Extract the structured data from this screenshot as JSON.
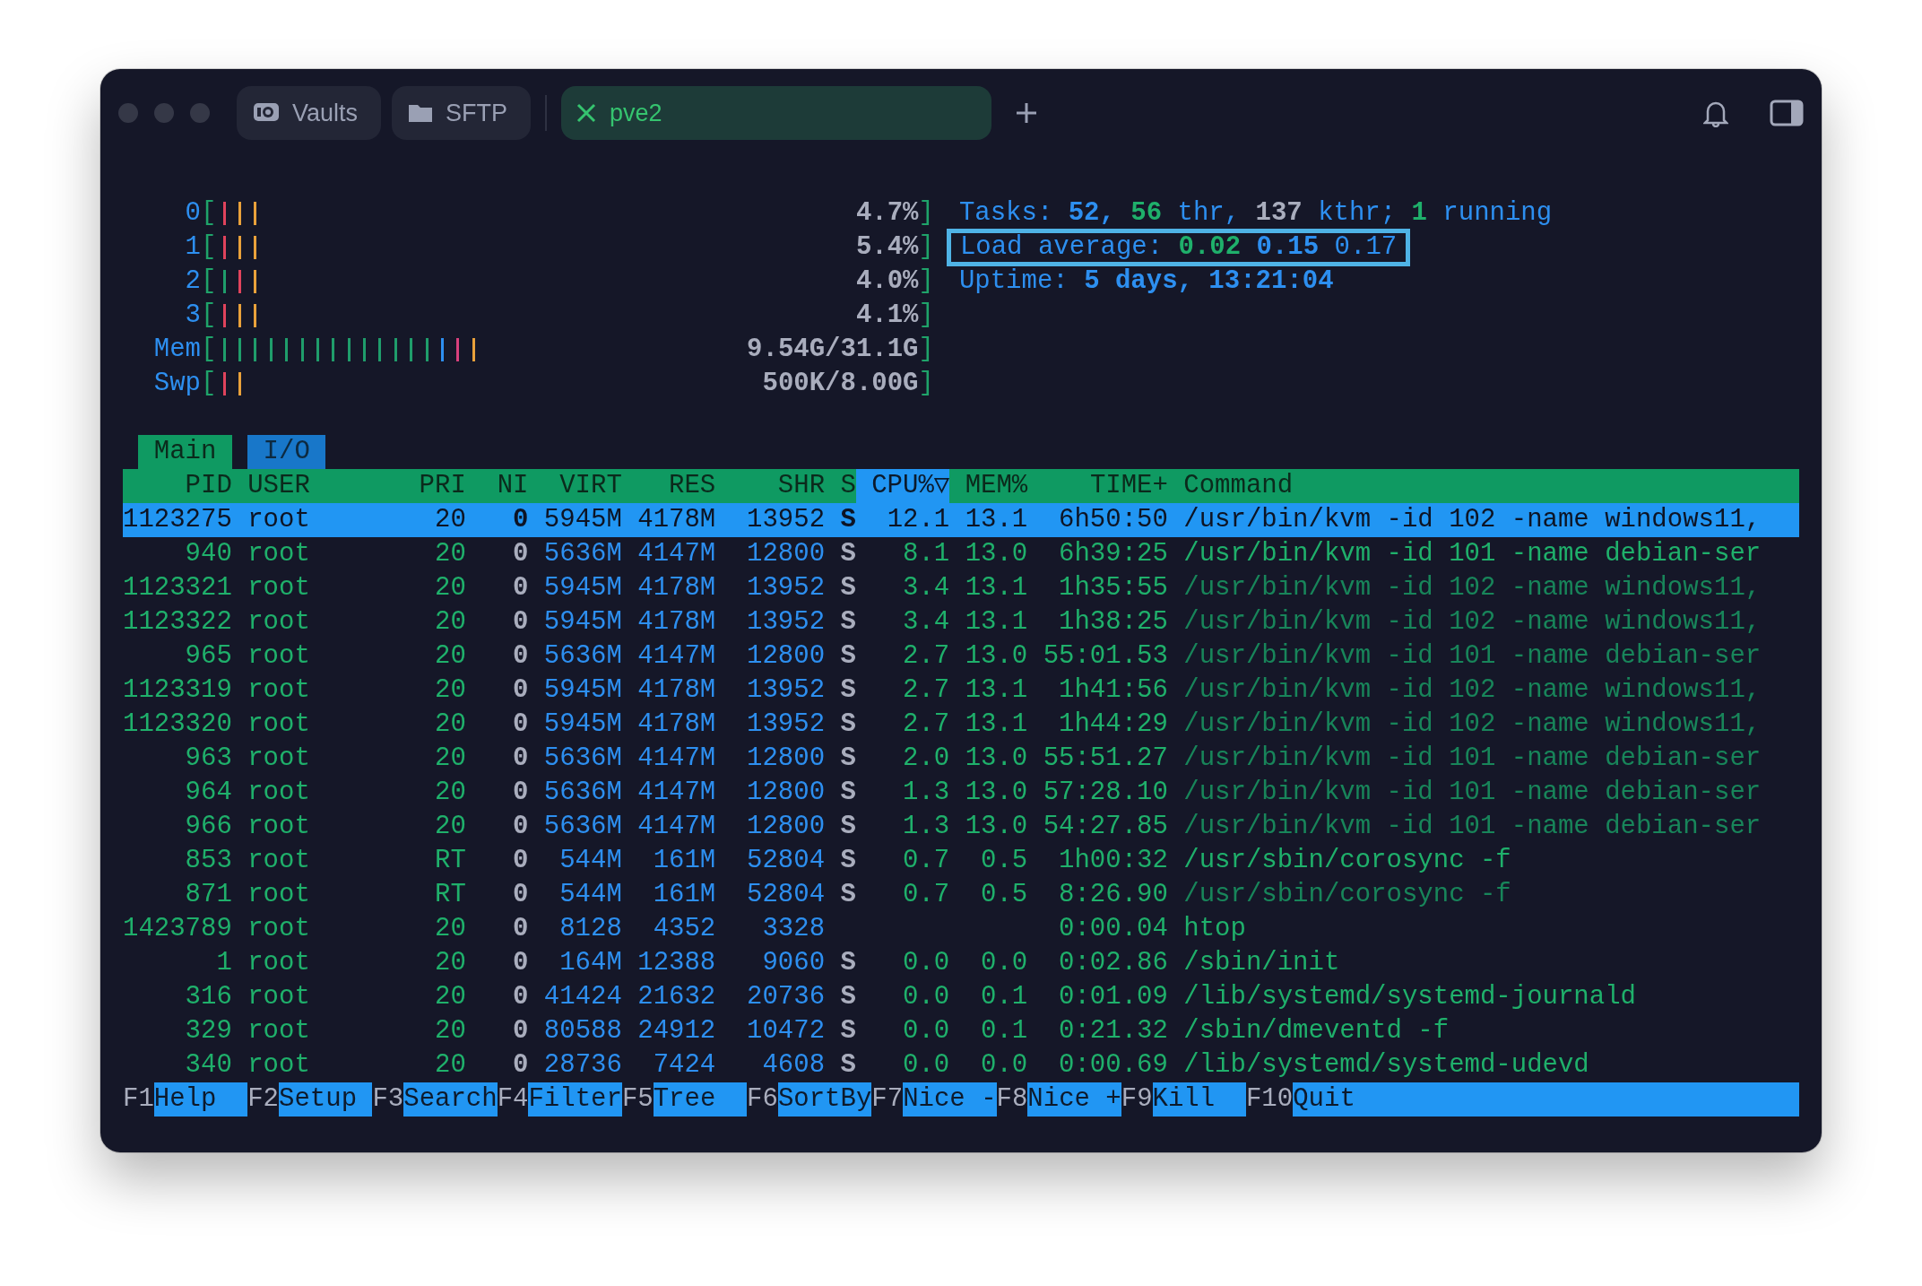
{
  "window": {
    "tabs": [
      {
        "label": "Vaults",
        "kind": "vault",
        "selected": false
      },
      {
        "label": "SFTP",
        "kind": "folder",
        "selected": false
      },
      {
        "label": "pve2",
        "kind": "cross",
        "selected": true
      }
    ]
  },
  "meters": [
    {
      "label": "0",
      "open": "[",
      "value": "4.7%",
      "close": "]",
      "bars": [
        {
          "color": "#e0435c"
        },
        {
          "color": "#e9a13b"
        },
        {
          "color": "#e9a13b"
        }
      ]
    },
    {
      "label": "1",
      "open": "[",
      "value": "5.4%",
      "close": "]",
      "bars": [
        {
          "color": "#e0435c"
        },
        {
          "color": "#e9a13b"
        },
        {
          "color": "#e9a13b"
        }
      ]
    },
    {
      "label": "2",
      "open": "[",
      "value": "4.0%",
      "close": "]",
      "bars": [
        {
          "color": "#1f9d6b"
        },
        {
          "color": "#e0435c"
        },
        {
          "color": "#e9a13b"
        }
      ]
    },
    {
      "label": "3",
      "open": "[",
      "value": "4.1%",
      "close": "]",
      "bars": [
        {
          "color": "#e0435c"
        },
        {
          "color": "#e9a13b"
        },
        {
          "color": "#e9a13b"
        }
      ]
    },
    {
      "label": "Mem",
      "open": "[",
      "value": "9.54G/31.1G",
      "close": "]",
      "bars": [
        {
          "color": "#1f9d6b"
        },
        {
          "color": "#1f9d6b"
        },
        {
          "color": "#1f9d6b"
        },
        {
          "color": "#1f9d6b"
        },
        {
          "color": "#1f9d6b"
        },
        {
          "color": "#1f9d6b"
        },
        {
          "color": "#1f9d6b"
        },
        {
          "color": "#1f9d6b"
        },
        {
          "color": "#1f9d6b"
        },
        {
          "color": "#1f9d6b"
        },
        {
          "color": "#1f9d6b"
        },
        {
          "color": "#1f9d6b"
        },
        {
          "color": "#1f9d6b"
        },
        {
          "color": "#1f9d6b"
        },
        {
          "color": "#2d8ff0"
        },
        {
          "color": "#d8407c"
        },
        {
          "color": "#e9a13b"
        }
      ]
    },
    {
      "label": "Swp",
      "open": "[",
      "value": "500K/8.00G",
      "close": "]",
      "bars": [
        {
          "color": "#e0435c"
        },
        {
          "color": "#e9a13b"
        }
      ]
    }
  ],
  "summary": [
    {
      "highlighted": false,
      "segments": [
        {
          "text": "Tasks:",
          "kind": "label"
        },
        {
          "text": "52,",
          "kind": "strong"
        },
        {
          "text": "56",
          "kind": "accent"
        },
        {
          "text": "thr,",
          "kind": "label"
        },
        {
          "text": "137",
          "kind": "grey"
        },
        {
          "text": "kthr;",
          "kind": "label"
        },
        {
          "text": "1",
          "kind": "accent"
        },
        {
          "text": "running",
          "kind": "label"
        }
      ]
    },
    {
      "highlighted": true,
      "segments": [
        {
          "text": "Load average:",
          "kind": "label"
        },
        {
          "text": "0.02",
          "kind": "accent"
        },
        {
          "text": "0.15",
          "kind": "strong"
        },
        {
          "text": "0.17",
          "kind": "label"
        }
      ]
    },
    {
      "highlighted": false,
      "segments": [
        {
          "text": "Uptime:",
          "kind": "label"
        },
        {
          "text": "5 days, 13:21:04",
          "kind": "strong"
        }
      ]
    }
  ],
  "view_tabs": [
    {
      "label": "Main",
      "selected": true
    },
    {
      "label": "I/O",
      "selected": false
    }
  ],
  "table": {
    "columns": [
      {
        "label": "PID",
        "sorted": false
      },
      {
        "label": "USER",
        "sorted": false
      },
      {
        "label": "PRI",
        "sorted": false
      },
      {
        "label": "NI",
        "sorted": false
      },
      {
        "label": "VIRT",
        "sorted": false
      },
      {
        "label": "RES",
        "sorted": false
      },
      {
        "label": "SHR",
        "sorted": false
      },
      {
        "label": "S",
        "sorted": false
      },
      {
        "label": "CPU%▽",
        "sorted": true
      },
      {
        "label": "MEM%",
        "sorted": false
      },
      {
        "label": "TIME+",
        "sorted": false
      },
      {
        "label": "Command",
        "sorted": false
      }
    ],
    "rows": [
      {
        "selected": true,
        "thread": true,
        "cells": [
          "1123275",
          "root",
          "20",
          "0",
          "5945M",
          "4178M",
          "13952",
          "S",
          "12.1",
          "13.1",
          "6h50:50",
          "/usr/bin/kvm -id 102 -name windows11,"
        ]
      },
      {
        "selected": false,
        "thread": false,
        "cells": [
          "940",
          "root",
          "20",
          "0",
          "5636M",
          "4147M",
          "12800",
          "S",
          "8.1",
          "13.0",
          "6h39:25",
          "/usr/bin/kvm -id 101 -name debian-ser"
        ]
      },
      {
        "selected": false,
        "thread": true,
        "cells": [
          "1123321",
          "root",
          "20",
          "0",
          "5945M",
          "4178M",
          "13952",
          "S",
          "3.4",
          "13.1",
          "1h35:55",
          "/usr/bin/kvm -id 102 -name windows11,"
        ]
      },
      {
        "selected": false,
        "thread": true,
        "cells": [
          "1123322",
          "root",
          "20",
          "0",
          "5945M",
          "4178M",
          "13952",
          "S",
          "3.4",
          "13.1",
          "1h38:25",
          "/usr/bin/kvm -id 102 -name windows11,"
        ]
      },
      {
        "selected": false,
        "thread": true,
        "cells": [
          "965",
          "root",
          "20",
          "0",
          "5636M",
          "4147M",
          "12800",
          "S",
          "2.7",
          "13.0",
          "55:01.53",
          "/usr/bin/kvm -id 101 -name debian-ser"
        ]
      },
      {
        "selected": false,
        "thread": true,
        "cells": [
          "1123319",
          "root",
          "20",
          "0",
          "5945M",
          "4178M",
          "13952",
          "S",
          "2.7",
          "13.1",
          "1h41:56",
          "/usr/bin/kvm -id 102 -name windows11,"
        ]
      },
      {
        "selected": false,
        "thread": true,
        "cells": [
          "1123320",
          "root",
          "20",
          "0",
          "5945M",
          "4178M",
          "13952",
          "S",
          "2.7",
          "13.1",
          "1h44:29",
          "/usr/bin/kvm -id 102 -name windows11,"
        ]
      },
      {
        "selected": false,
        "thread": true,
        "cells": [
          "963",
          "root",
          "20",
          "0",
          "5636M",
          "4147M",
          "12800",
          "S",
          "2.0",
          "13.0",
          "55:51.27",
          "/usr/bin/kvm -id 101 -name debian-ser"
        ]
      },
      {
        "selected": false,
        "thread": true,
        "cells": [
          "964",
          "root",
          "20",
          "0",
          "5636M",
          "4147M",
          "12800",
          "S",
          "1.3",
          "13.0",
          "57:28.10",
          "/usr/bin/kvm -id 101 -name debian-ser"
        ]
      },
      {
        "selected": false,
        "thread": true,
        "cells": [
          "966",
          "root",
          "20",
          "0",
          "5636M",
          "4147M",
          "12800",
          "S",
          "1.3",
          "13.0",
          "54:27.85",
          "/usr/bin/kvm -id 101 -name debian-ser"
        ]
      },
      {
        "selected": false,
        "thread": false,
        "cells": [
          "853",
          "root",
          "RT",
          "0",
          "544M",
          "161M",
          "52804",
          "S",
          "0.7",
          "0.5",
          "1h00:32",
          "/usr/sbin/corosync -f"
        ]
      },
      {
        "selected": false,
        "thread": true,
        "cells": [
          "871",
          "root",
          "RT",
          "0",
          "544M",
          "161M",
          "52804",
          "S",
          "0.7",
          "0.5",
          "8:26.90",
          "/usr/sbin/corosync -f"
        ]
      },
      {
        "selected": false,
        "thread": false,
        "cells": [
          "1423789",
          "root",
          "20",
          "0",
          "8128",
          "4352",
          "3328",
          null,
          null,
          null,
          "0:00.04",
          "htop"
        ]
      },
      {
        "selected": false,
        "thread": false,
        "cells": [
          "1",
          "root",
          "20",
          "0",
          "164M",
          "12388",
          "9060",
          "S",
          "0.0",
          "0.0",
          "0:02.86",
          "/sbin/init"
        ]
      },
      {
        "selected": false,
        "thread": false,
        "cells": [
          "316",
          "root",
          "20",
          "0",
          "41424",
          "21632",
          "20736",
          "S",
          "0.0",
          "0.1",
          "0:01.09",
          "/lib/systemd/systemd-journald"
        ]
      },
      {
        "selected": false,
        "thread": false,
        "cells": [
          "329",
          "root",
          "20",
          "0",
          "80588",
          "24912",
          "10472",
          "S",
          "0.0",
          "0.1",
          "0:21.32",
          "/sbin/dmeventd -f"
        ]
      },
      {
        "selected": false,
        "thread": false,
        "cells": [
          "340",
          "root",
          "20",
          "0",
          "28736",
          "7424",
          "4608",
          "S",
          "0.0",
          "0.0",
          "0:00.69",
          "/lib/systemd/systemd-udevd"
        ]
      }
    ]
  },
  "function_keys": [
    {
      "key": "F1",
      "label": "Help"
    },
    {
      "key": "F2",
      "label": "Setup"
    },
    {
      "key": "F3",
      "label": "Search"
    },
    {
      "key": "F4",
      "label": "Filter"
    },
    {
      "key": "F5",
      "label": "Tree"
    },
    {
      "key": "F6",
      "label": "SortBy"
    },
    {
      "key": "F7",
      "label": "Nice -"
    },
    {
      "key": "F8",
      "label": "Nice +"
    },
    {
      "key": "F9",
      "label": "Kill"
    },
    {
      "key": "F10",
      "label": "Quit"
    }
  ]
}
